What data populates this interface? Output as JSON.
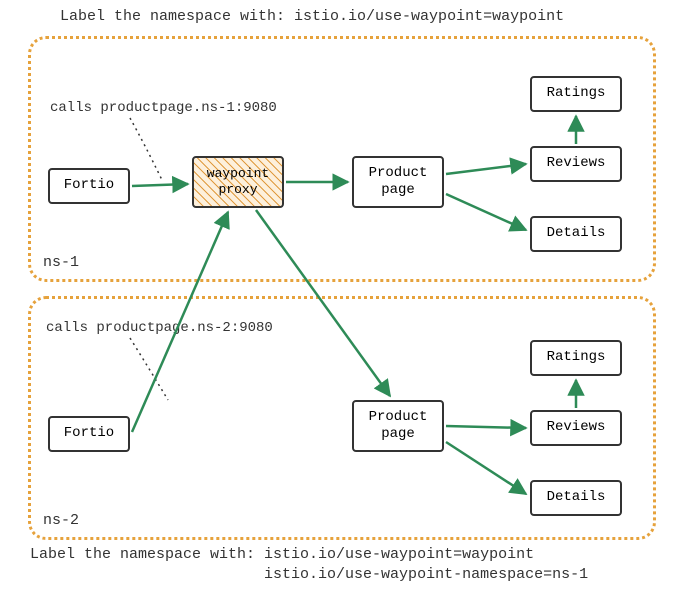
{
  "title_top": "Label the namespace with: istio.io/use-waypoint=waypoint",
  "title_bottom": "Label the namespace with: istio.io/use-waypoint=waypoint\n                          istio.io/use-waypoint-namespace=ns-1",
  "ns1": {
    "name": "ns-1",
    "call_label": "calls productpage.ns-1:9080",
    "fortio": "Fortio",
    "waypoint": "waypoint\nproxy",
    "product": "Product\npage",
    "ratings": "Ratings",
    "reviews": "Reviews",
    "details": "Details"
  },
  "ns2": {
    "name": "ns-2",
    "call_label": "calls productpage.ns-2:9080",
    "fortio": "Fortio",
    "product": "Product\npage",
    "ratings": "Ratings",
    "reviews": "Reviews",
    "details": "Details"
  },
  "colors": {
    "arrow": "#2e8b57",
    "dash": "#333"
  }
}
